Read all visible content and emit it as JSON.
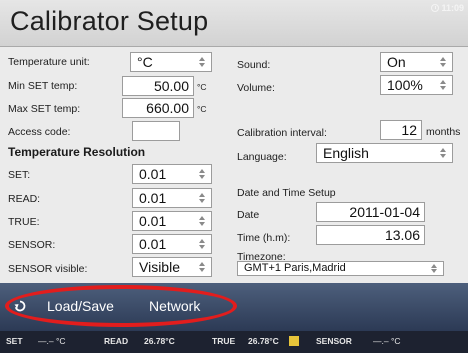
{
  "window": {
    "title": "Calibrator Setup",
    "clock": "11:09"
  },
  "left": {
    "temperature_unit": {
      "label": "Temperature unit:",
      "value": "°C"
    },
    "min_set_temp": {
      "label": "Min SET temp:",
      "value": "50.00",
      "unit": "°C"
    },
    "max_set_temp": {
      "label": "Max SET temp:",
      "value": "660.00",
      "unit": "°C"
    },
    "access_code": {
      "label": "Access code:",
      "value": ""
    },
    "resolution_heading": "Temperature Resolution",
    "set": {
      "label": "SET:",
      "value": "0.01"
    },
    "read": {
      "label": "READ:",
      "value": "0.01"
    },
    "true": {
      "label": "TRUE:",
      "value": "0.01"
    },
    "sensor": {
      "label": "SENSOR:",
      "value": "0.01"
    },
    "sensor_visible": {
      "label": "SENSOR visible:",
      "value": "Visible"
    }
  },
  "right": {
    "sound": {
      "label": "Sound:",
      "value": "On"
    },
    "volume": {
      "label": "Volume:",
      "value": "100%"
    },
    "calibration_interval": {
      "label": "Calibration interval:",
      "value": "12",
      "unit": "months"
    },
    "language": {
      "label": "Language:",
      "value": "English"
    },
    "datetime_heading": "Date and Time Setup",
    "date": {
      "label": "Date",
      "value": "2011-01-04"
    },
    "time": {
      "label": "Time (h.m):",
      "value": "13.06"
    },
    "timezone": {
      "label": "Timezone:",
      "value": "GMT+1 Paris,Madrid"
    }
  },
  "function_bar": {
    "load_save": "Load/Save",
    "network": "Network"
  },
  "status_bar": {
    "set_label": "SET",
    "set_value": "—.– °C",
    "read_label": "READ",
    "read_value": "26.78°C",
    "true_label": "TRUE",
    "true_value": "26.78°C",
    "sensor_label": "SENSOR",
    "sensor_value": "—.– °C"
  },
  "colors": {
    "highlight": "#e21d1d",
    "function_bar": "#3b4b68",
    "status_bar": "#1d2230",
    "badge": "#e7c43a"
  },
  "icons": [
    "clock-icon",
    "back-icon",
    "spin-icon",
    "dropdown-icon"
  ]
}
